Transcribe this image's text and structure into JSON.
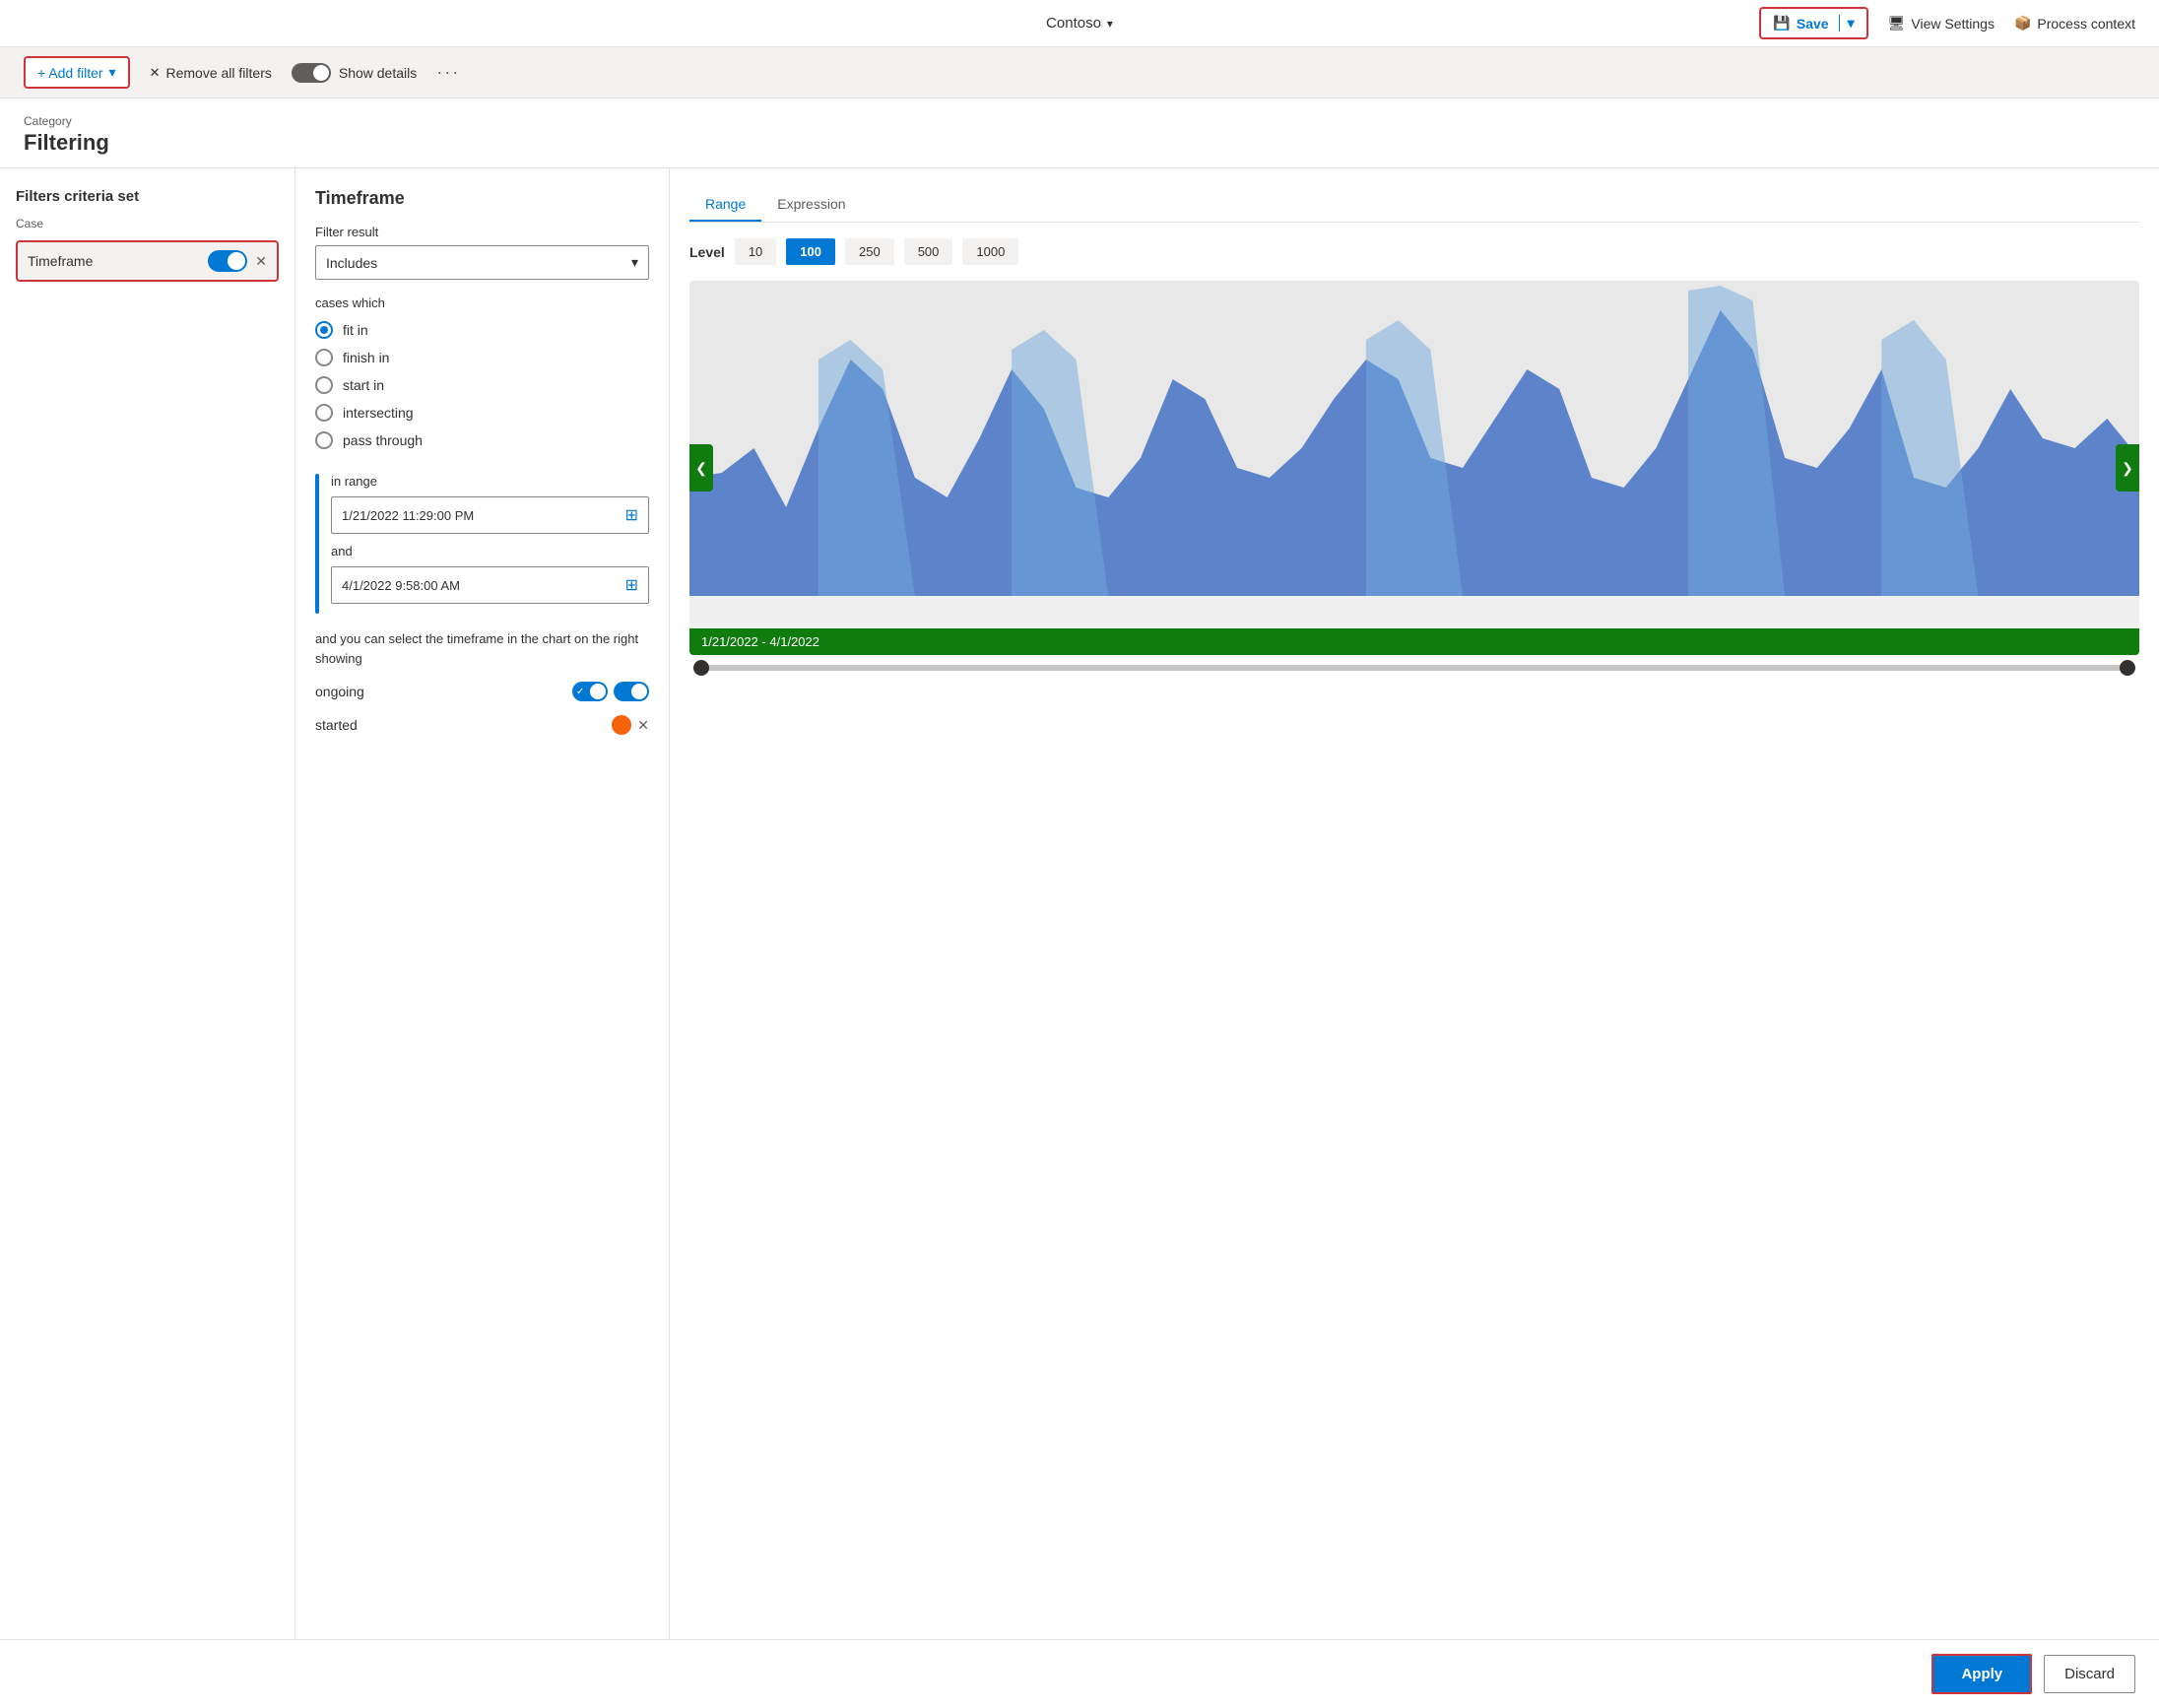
{
  "app": {
    "company": "Contoso",
    "save_label": "Save",
    "view_settings_label": "View Settings",
    "process_context_label": "Process context"
  },
  "toolbar": {
    "add_filter_label": "+ Add filter",
    "remove_filters_label": "Remove all filters",
    "show_details_label": "Show details"
  },
  "page": {
    "category": "Category",
    "title": "Filtering"
  },
  "left_panel": {
    "section_title": "Filters criteria set",
    "sub_title": "Case",
    "filter_item_label": "Timeframe"
  },
  "middle_panel": {
    "title": "Timeframe",
    "filter_result_label": "Filter result",
    "filter_result_value": "Includes",
    "cases_which_label": "cases which",
    "radio_options": [
      {
        "id": "fit_in",
        "label": "fit in",
        "selected": true
      },
      {
        "id": "finish_in",
        "label": "finish in",
        "selected": false
      },
      {
        "id": "start_in",
        "label": "start in",
        "selected": false
      },
      {
        "id": "intersecting",
        "label": "intersecting",
        "selected": false
      },
      {
        "id": "pass_through",
        "label": "pass through",
        "selected": false
      }
    ],
    "in_range_label": "in range",
    "date_from": "1/21/2022 11:29:00 PM",
    "and_label": "and",
    "date_to": "4/1/2022 9:58:00 AM",
    "hint_text": "and you can select the timeframe in the chart on the right showing",
    "ongoing_label": "ongoing",
    "started_label": "started"
  },
  "right_panel": {
    "tabs": [
      {
        "id": "range",
        "label": "Range",
        "active": true
      },
      {
        "id": "expression",
        "label": "Expression",
        "active": false
      }
    ],
    "level_label": "Level",
    "level_options": [
      {
        "value": "10",
        "active": false
      },
      {
        "value": "100",
        "active": true
      },
      {
        "value": "250",
        "active": false
      },
      {
        "value": "500",
        "active": false
      },
      {
        "value": "1000",
        "active": false
      }
    ],
    "chart_footer": "1/21/2022 - 4/1/2022"
  },
  "bottom": {
    "apply_label": "Apply",
    "discard_label": "Discard"
  }
}
